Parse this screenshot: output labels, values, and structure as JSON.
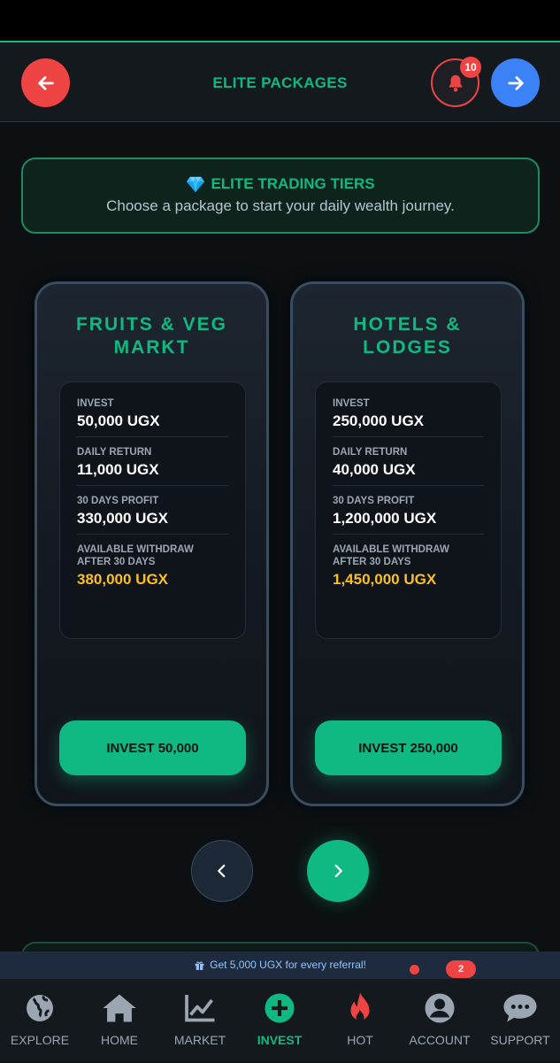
{
  "header": {
    "title": "ELITE PACKAGES",
    "notification_count": "10"
  },
  "banner": {
    "title": "ELITE TRADING TIERS",
    "subtitle": "Choose a package to start your daily wealth journey."
  },
  "packages": [
    {
      "name_line1": "FRUITS & VEG",
      "name_line2": "MARKT",
      "invest_label": "INVEST",
      "invest_value": "50,000 UGX",
      "daily_label": "DAILY RETURN",
      "daily_value": "11,000 UGX",
      "profit_label": "30 DAYS PROFIT",
      "profit_value": "330,000 UGX",
      "withdraw_label_line1": "AVAILABLE WITHDRAW",
      "withdraw_label_line2": "AFTER 30 DAYS",
      "withdraw_value": "380,000 UGX",
      "button": "INVEST 50,000"
    },
    {
      "name_line1": "HOTELS &",
      "name_line2": "LODGES",
      "invest_label": "INVEST",
      "invest_value": "250,000 UGX",
      "daily_label": "DAILY RETURN",
      "daily_value": "40,000 UGX",
      "profit_label": "30 DAYS PROFIT",
      "profit_value": "1,200,000 UGX",
      "withdraw_label_line1": "AVAILABLE WITHDRAW",
      "withdraw_label_line2": "AFTER 30 DAYS",
      "withdraw_value": "1,450,000 UGX",
      "button": "INVEST 250,000"
    }
  ],
  "referral": {
    "text": "Get 5,000 UGX for every referral!",
    "badge": "2"
  },
  "bottom_nav": [
    {
      "label": "EXPLORE",
      "icon": "globe-icon"
    },
    {
      "label": "HOME",
      "icon": "home-icon"
    },
    {
      "label": "MARKET",
      "icon": "chart-line-icon"
    },
    {
      "label": "INVEST",
      "icon": "plus-circle-icon",
      "active": true
    },
    {
      "label": "HOT",
      "icon": "fire-icon"
    },
    {
      "label": "ACCOUNT",
      "icon": "user-circle-icon"
    },
    {
      "label": "SUPPORT",
      "icon": "chat-icon"
    }
  ],
  "colors": {
    "accent": "#10b981",
    "danger": "#ef4444",
    "primary": "#3b82f6",
    "gold": "#fbbf24",
    "background": "#0c1013"
  }
}
